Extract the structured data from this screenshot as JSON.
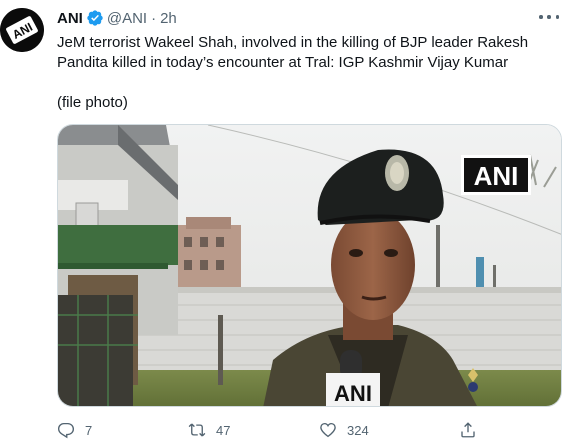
{
  "tweet": {
    "author_name": "ANI",
    "handle": "@ANI",
    "separator": "·",
    "time": "2h",
    "text_line_1": "JeM terrorist Wakeel Shah, involved in the killing of BJP leader Rakesh",
    "text_line_2": "Pandita killed in today’s encounter at Tral: IGP Kashmir Vijay Kumar",
    "text_line_3": "(file photo)",
    "avatar_label": "ANI",
    "media_watermark": "ANI",
    "mic_label": "ANI"
  },
  "actions": {
    "reply_count": "7",
    "retweet_count": "47",
    "like_count": "324"
  },
  "icons": {
    "verified": "verified-badge-icon",
    "more": "more-icon",
    "reply": "reply-icon",
    "retweet": "retweet-icon",
    "like": "like-icon",
    "share": "share-icon"
  },
  "colors": {
    "verified_blue": "#1d9bf0",
    "secondary_text": "#536471",
    "primary_text": "#0f1419"
  }
}
